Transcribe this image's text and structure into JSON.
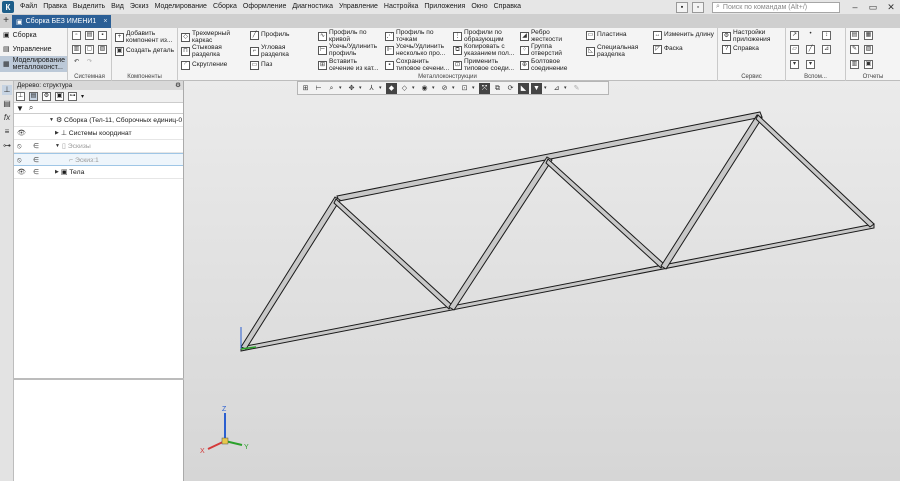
{
  "window": {
    "menu": [
      "Файл",
      "Правка",
      "Выделить",
      "Вид",
      "Эскиз",
      "Моделирование",
      "Сборка",
      "Оформление",
      "Диагностика",
      "Управление",
      "Настройка",
      "Приложения",
      "Окно",
      "Справка"
    ],
    "search_placeholder": "Поиск по командам (Alt+/)",
    "logo_glyph": "К"
  },
  "tabs": {
    "active_label": "Сборка БЕЗ ИМЕНИ1",
    "close_glyph": "×",
    "new_glyph": "+"
  },
  "ribbon": {
    "modes": [
      "Сборка",
      "Управление",
      "Моделирование металлоконст..."
    ],
    "groups": {
      "system": "Системная",
      "components": "Компоненты",
      "metal": "Металлоконструкции",
      "service": "Сервис",
      "aux": "Вспом...",
      "reports": "Отчеты"
    },
    "components": {
      "add": "Добавить компонент из...",
      "create": "Создать деталь"
    },
    "metal": {
      "frame3d": "Трехмерный каркас",
      "butt_joint": "Стыковая разделка",
      "fillet": "Скругление",
      "profile": "Профиль",
      "corner_joint": "Угловая разделка",
      "slot": "Паз",
      "profile_curve": "Профиль по кривой",
      "trim_extend": "Усечь/Удлинить профиль",
      "insert_section": "Вставить сечение из кат...",
      "profile_points": "Профиль по точкам",
      "trim_multi": "Усечь/Удлинить несколько про...",
      "save_section": "Сохранить типовое сечени...",
      "profile_gen": "Профили по образующим",
      "copy_indicated": "Копировать с указанием пол...",
      "apply_section": "Применить типовое соеди...",
      "rib": "Ребро жесткости",
      "hole_group": "Группа отверстий",
      "bolt_conn": "Болтовое соединение",
      "plate": "Пластина",
      "special_cut": "Специальная разделка",
      "change_length": "Изменить длину",
      "chamfer": "Фаска"
    },
    "service": {
      "app_settings": "Настройки приложения",
      "help": "Справка"
    }
  },
  "tree": {
    "title": "Дерево: структура",
    "items": [
      {
        "label": "Сборка (Тел-11, Сборочных единиц-0",
        "visible": true
      },
      {
        "label": "Системы координат",
        "visible": true
      },
      {
        "label": "Эскизы",
        "visible": true
      },
      {
        "label": "Эскиз:1",
        "visible": false
      },
      {
        "label": "Тела",
        "visible": true
      }
    ]
  },
  "triad": {
    "z": "Z",
    "x": "X",
    "y": "Y"
  },
  "colors": {
    "accent": "#2b5f96",
    "truss_face": "#c9c9c9",
    "truss_edge": "#1a1a1a",
    "viewport_top": "#ebebeb",
    "viewport_bottom": "#d6d6d6"
  }
}
